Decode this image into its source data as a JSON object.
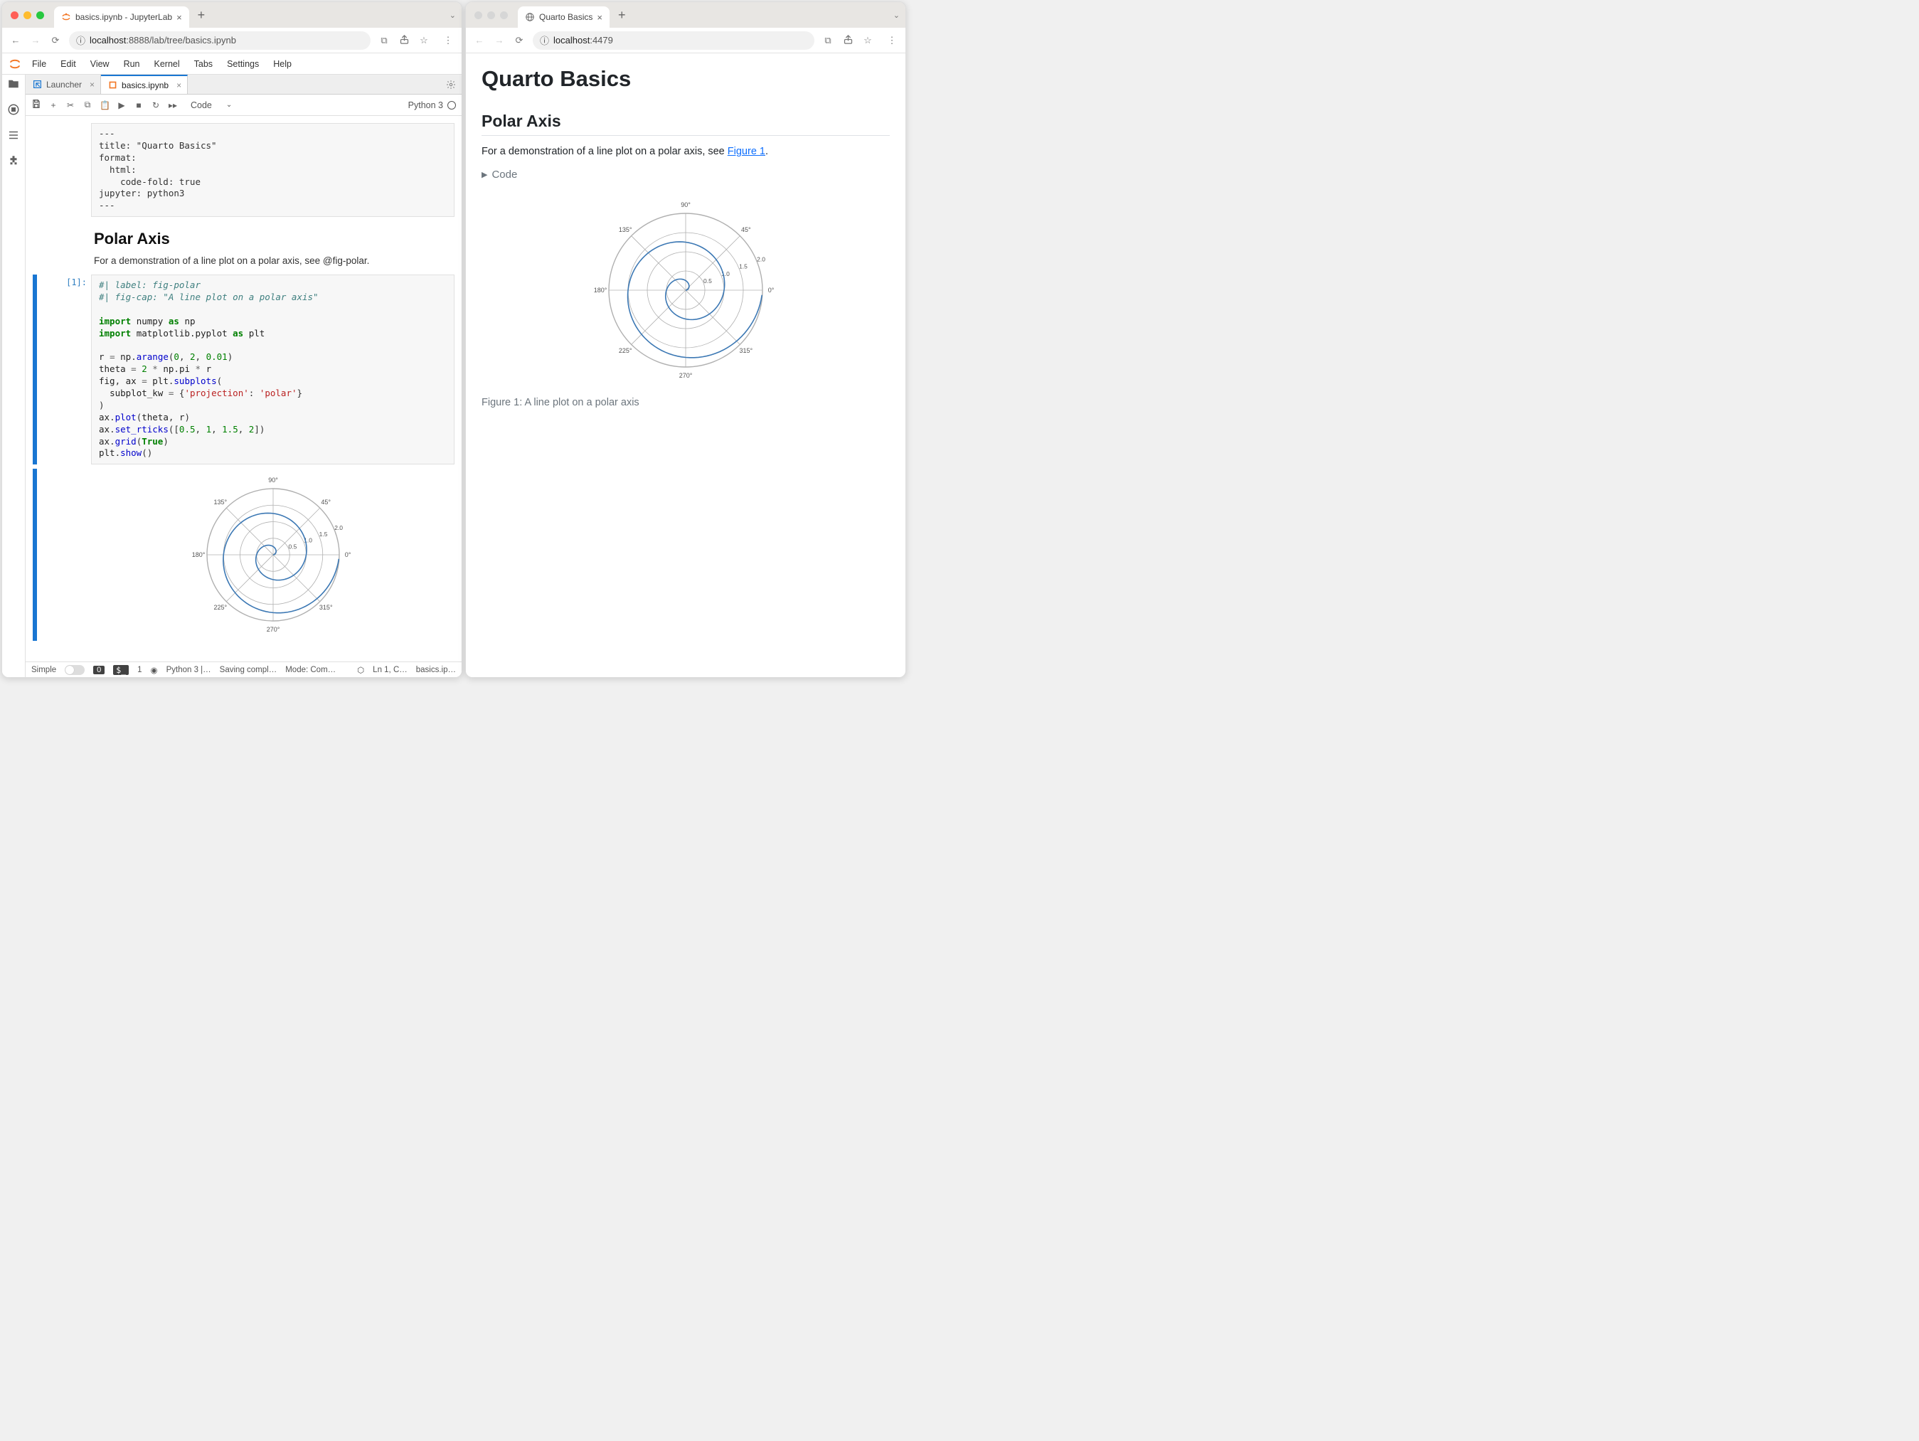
{
  "left_window": {
    "browser_tab_title": "basics.ipynb - JupyterLab",
    "address": {
      "prefix": "localhost",
      "suffix": ":8888/lab/tree/basics.ipynb"
    },
    "menubar": [
      "File",
      "Edit",
      "View",
      "Run",
      "Kernel",
      "Tabs",
      "Settings",
      "Help"
    ],
    "doc_tabs": [
      {
        "label": "Launcher",
        "icon": "launcher-icon",
        "active": false
      },
      {
        "label": "basics.ipynb",
        "icon": "notebook-icon",
        "active": true
      }
    ],
    "toolbar": {
      "cell_type": "Code",
      "kernel": "Python 3"
    },
    "cells": {
      "raw": "---\ntitle: \"Quarto Basics\"\nformat:\n  html:\n    code-fold: true\njupyter: python3\n---",
      "md_heading": "Polar Axis",
      "md_text": "For a demonstration of a line plot on a polar axis, see @fig-polar.",
      "code_prompt": "[1]:"
    },
    "statusbar": {
      "simple": "Simple",
      "errors": "0",
      "terminals": "1",
      "kernel": "Python 3 |…",
      "saving": "Saving compl…",
      "mode": "Mode: Com…",
      "ln": "Ln 1, C…",
      "file": "basics.ip…"
    }
  },
  "right_window": {
    "browser_tab_title": "Quarto Basics",
    "address": {
      "prefix": "localhost",
      "suffix": ":4479"
    },
    "title": "Quarto Basics",
    "section": "Polar Axis",
    "body_pre": "For a demonstration of a line plot on a polar axis, see ",
    "body_link": "Figure 1",
    "body_post": ".",
    "code_toggle": "Code",
    "caption": "Figure 1: A line plot on a polar axis"
  },
  "chart_data": {
    "type": "line",
    "projection": "polar",
    "title": "",
    "r_ticks": [
      0.5,
      1.0,
      1.5,
      2.0
    ],
    "theta_ticks_deg": [
      0,
      45,
      90,
      135,
      180,
      225,
      270,
      315
    ],
    "series": [
      {
        "name": "r = theta/(2π) over r∈[0,2)",
        "r_range": [
          0,
          2
        ],
        "r_step": 0.01,
        "relation": "theta = 2*pi*r"
      }
    ],
    "color": "#3c78b4"
  }
}
